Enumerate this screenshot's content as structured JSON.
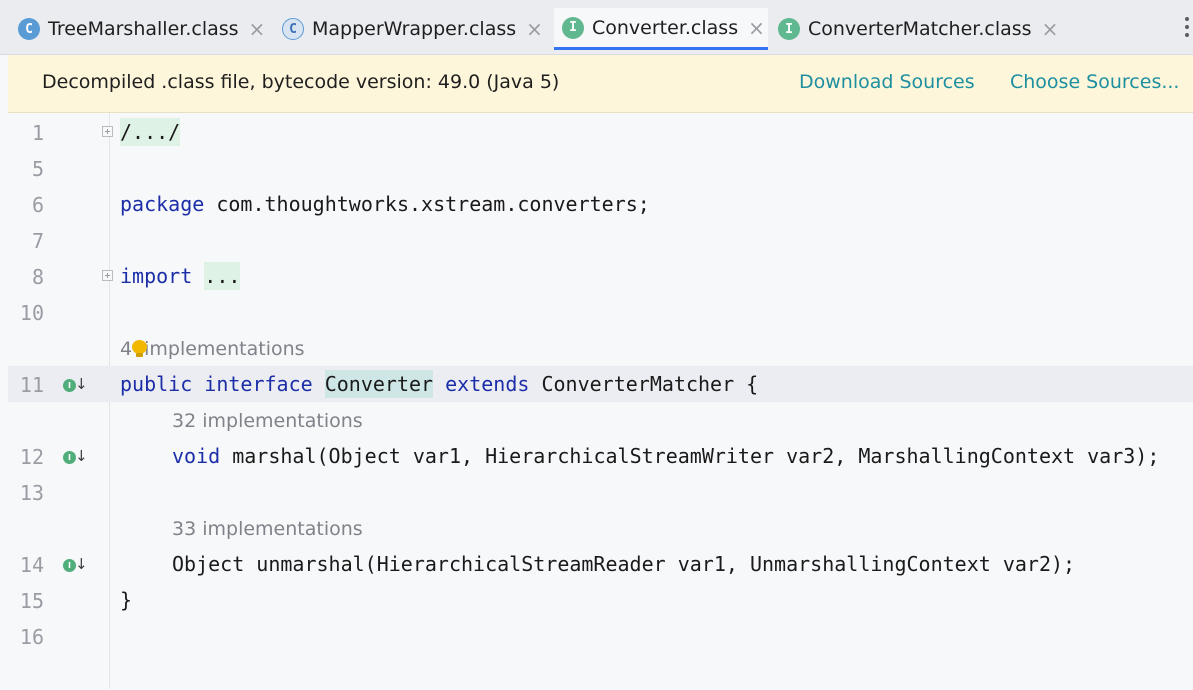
{
  "tabs": [
    {
      "label": "TreeMarshaller.class",
      "icon": "C",
      "kind": "class"
    },
    {
      "label": "MapperWrapper.class",
      "icon": "C",
      "kind": "class-alt"
    },
    {
      "label": "Converter.class",
      "icon": "I",
      "kind": "interface",
      "active": true
    },
    {
      "label": "ConverterMatcher.class",
      "icon": "I",
      "kind": "interface"
    }
  ],
  "tab_close_glyph": "×",
  "banner": {
    "message": "Decompiled .class file, bytecode version: 49.0 (Java 5)",
    "download_sources": "Download Sources",
    "choose_sources": "Choose Sources..."
  },
  "editor": {
    "line_numbers": [
      "1",
      "5",
      "6",
      "7",
      "8",
      "10",
      "11",
      "12",
      "13",
      "14",
      "15",
      "16"
    ],
    "line1_code": "/.../",
    "line6_kw": "package",
    "line6_rest": " com.thoughtworks.xstream.converters;",
    "line8_kw": "import",
    "line8_fold": "...",
    "hint_interface_count": "4",
    "hint_interface_text": "implementations",
    "line11_kw1": "public",
    "line11_kw2": "interface",
    "line11_name": "Converter",
    "line11_kw3": "extends",
    "line11_rest": " ConverterMatcher {",
    "hint_marshal": "32 implementations",
    "line12_kw": "void",
    "line12_rest": " marshal(Object var1, HierarchicalStreamWriter var2, MarshallingContext var3);",
    "hint_unmarshal": "33 implementations",
    "line14_code": "Object unmarshal(HierarchicalStreamReader var1, UnmarshallingContext var2);",
    "line15_code": "}",
    "impl_marker_letter": "I"
  },
  "colors": {
    "keyword": "#1b2ea8",
    "link": "#1e8fa0",
    "banner_bg": "#fdf6da",
    "active_tab_underline": "#3574f0",
    "interface_icon": "#5fb88f",
    "class_icon": "#5a9bd5"
  },
  "icons": [
    "class-icon",
    "interface-icon",
    "close-icon",
    "more-options-icon",
    "fold-expand-icon",
    "implemented-by-icon",
    "lightbulb-icon"
  ]
}
